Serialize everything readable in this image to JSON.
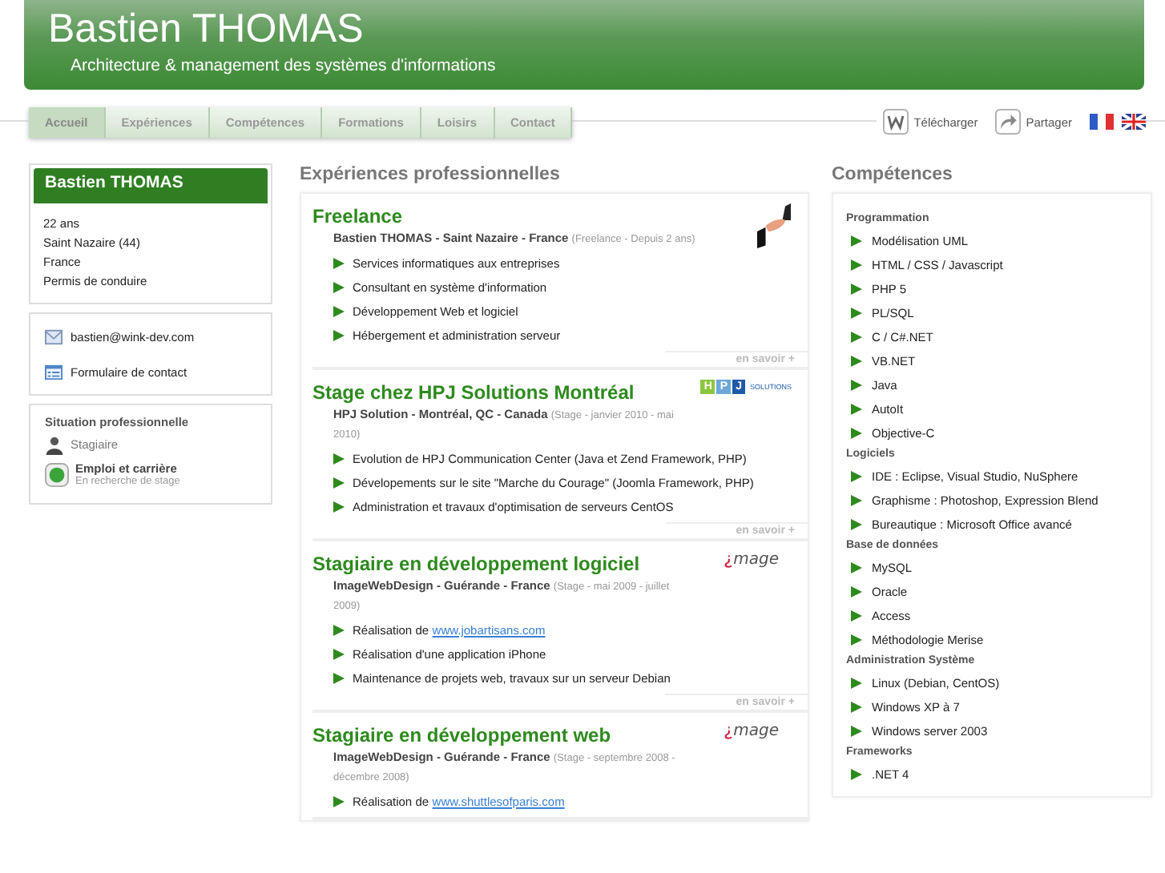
{
  "header": {
    "title": "Bastien THOMAS",
    "subtitle": "Architecture & management des systèmes d'informations"
  },
  "nav": [
    {
      "label": "Accueil",
      "selected": true
    },
    {
      "label": "Expériences",
      "selected": false
    },
    {
      "label": "Compétences",
      "selected": false
    },
    {
      "label": "Formations",
      "selected": false
    },
    {
      "label": "Loisirs",
      "selected": false
    },
    {
      "label": "Contact",
      "selected": false
    }
  ],
  "actions": [
    {
      "kind": "download",
      "label": "Télécharger"
    },
    {
      "kind": "share",
      "label": "Partager"
    }
  ],
  "languages": [
    {
      "kind": "fr"
    },
    {
      "kind": "en"
    }
  ],
  "profile": {
    "name": "Bastien THOMAS",
    "details": [
      "22 ans",
      "Saint Nazaire (44)",
      "France",
      "Permis de conduire"
    ]
  },
  "contact": [
    {
      "kind": "email",
      "label": "bastien@wink-dev.com"
    },
    {
      "kind": "form",
      "label": "Formulaire de contact"
    }
  ],
  "situation": {
    "title": "Situation professionnelle",
    "status": "Stagiaire",
    "job_title": "Emploi et carrière",
    "job_note": "En recherche de stage"
  },
  "experiences_title": "Expériences professionnelles",
  "experiences": [
    {
      "title": "Freelance",
      "logo": {
        "kind": "handshake"
      },
      "org": "Bastien THOMAS - Saint Nazaire - France",
      "period": "(Freelance - Depuis 2 ans)",
      "items": [
        {
          "text": "Services informatiques aux entreprises"
        },
        {
          "text": "Consultant en système d'information"
        },
        {
          "text": "Développement Web et logiciel"
        },
        {
          "text": "Hébergement et administration serveur"
        }
      ],
      "more": "en savoir +"
    },
    {
      "title": "Stage chez HPJ Solutions Montréal",
      "logo": {
        "kind": "hpj",
        "letters": [
          "H",
          "P",
          "J"
        ],
        "text": "SOLUTIONS"
      },
      "org": "HPJ Solution - Montréal, QC - Canada",
      "period": "(Stage - janvier 2010 - mai 2010)",
      "items": [
        {
          "text": "Evolution de HPJ Communication Center (Java et Zend Framework, PHP)"
        },
        {
          "text": "Dévelopements sur le site \"Marche du Courage\" (Joomla Framework, PHP)"
        },
        {
          "text": "Administration et travaux d'optimisation de serveurs CentOS"
        }
      ],
      "more": "en savoir +"
    },
    {
      "title": "Stagiaire en développement logiciel",
      "logo": {
        "kind": "mage",
        "text": "mage"
      },
      "org": "ImageWebDesign - Guérande - France",
      "period": "(Stage - mai 2009 - juillet 2009)",
      "items": [
        {
          "text": "Réalisation de",
          "link": "www.jobartisans.com"
        },
        {
          "text": "Réalisation d'une application iPhone"
        },
        {
          "text": "Maintenance de projets web, travaux sur un serveur Debian"
        }
      ],
      "more": "en savoir +"
    },
    {
      "title": "Stagiaire en développement web",
      "logo": {
        "kind": "mage",
        "text": "mage"
      },
      "org": "ImageWebDesign - Guérande - France",
      "period": "(Stage - septembre 2008 - décembre 2008)",
      "items": [
        {
          "text": "Réalisation de",
          "link": "www.shuttlesofparis.com"
        }
      ]
    }
  ],
  "skills_title": "Compétences",
  "skills": [
    {
      "name": "Programmation",
      "items": [
        "Modélisation UML",
        "HTML / CSS / Javascript",
        "PHP 5",
        "PL/SQL",
        "C / C#.NET",
        "VB.NET",
        "Java",
        "AutoIt",
        "Objective-C"
      ]
    },
    {
      "name": "Logiciels",
      "items": [
        "IDE : Eclipse, Visual Studio, NuSphere",
        "Graphisme : Photoshop, Expression Blend",
        "Bureautique : Microsoft Office avancé"
      ]
    },
    {
      "name": "Base de données",
      "items": [
        "MySQL",
        "Oracle",
        "Access",
        "Méthodologie Merise"
      ]
    },
    {
      "name": "Administration Système",
      "items": [
        "Linux (Debian, CentOS)",
        "Windows XP à 7",
        "Windows server 2003"
      ]
    },
    {
      "name": "Frameworks",
      "items": [
        ".NET 4"
      ]
    }
  ]
}
